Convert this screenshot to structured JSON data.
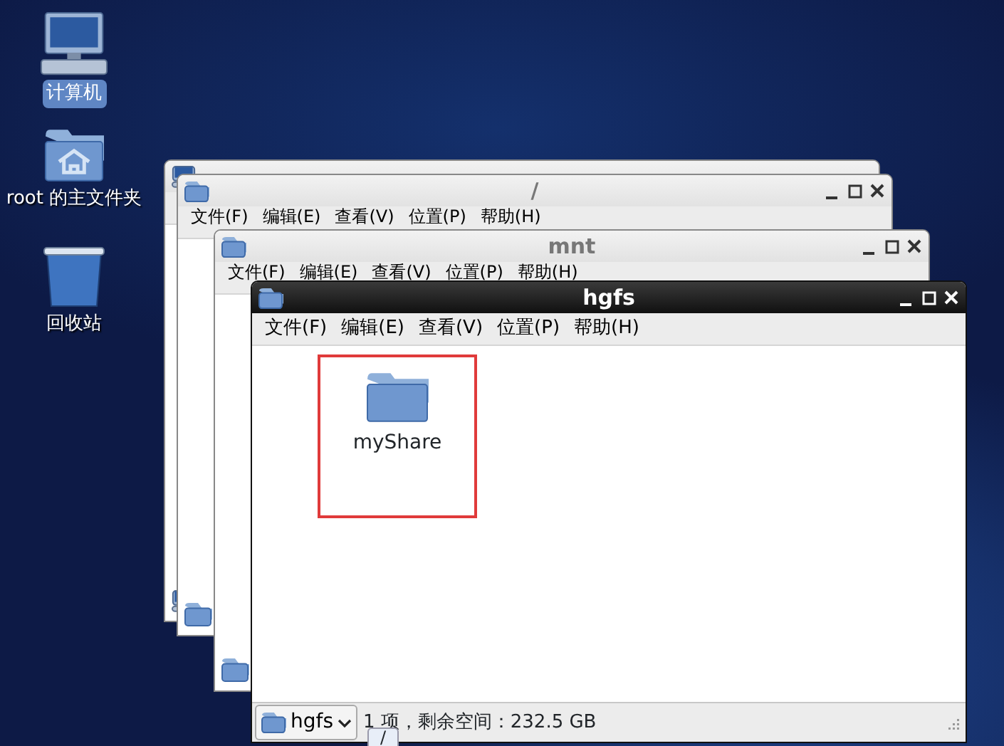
{
  "desktop_icons": [
    {
      "kind": "computer",
      "label": "计算机",
      "selected": true
    },
    {
      "kind": "home",
      "label": "root 的主文件夹",
      "selected": false
    },
    {
      "kind": "trash",
      "label": "回收站",
      "selected": false
    }
  ],
  "windows": [
    {
      "kind": "computer",
      "active": false
    },
    {
      "kind": "folder",
      "title": "/",
      "active": false,
      "menus": [
        "文件(F)",
        "编辑(E)",
        "查看(V)",
        "位置(P)",
        "帮助(H)"
      ]
    },
    {
      "kind": "folder",
      "title": "mnt",
      "active": false,
      "menus": [
        "文件(F)",
        "编辑(E)",
        "查看(V)",
        "位置(P)",
        "帮助(H)"
      ]
    },
    {
      "kind": "folder",
      "title": "hgfs",
      "active": true,
      "menus": [
        "文件(F)",
        "编辑(E)",
        "查看(V)",
        "位置(P)",
        "帮助(H)"
      ],
      "items": [
        {
          "label": "myShare",
          "marked": true
        }
      ],
      "path_button": "hgfs",
      "status": "1 项，剩余空间：232.5 GB",
      "tooltip": "/"
    }
  ]
}
